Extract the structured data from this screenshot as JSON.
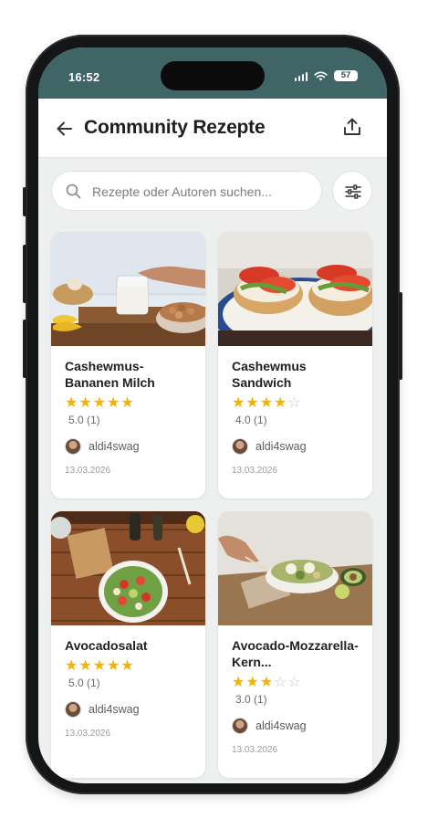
{
  "status_bar": {
    "time": "16:52",
    "battery": "57"
  },
  "header": {
    "title": "Community Rezepte"
  },
  "search": {
    "placeholder": "Rezepte oder Autoren suchen..."
  },
  "recipes": [
    {
      "title": "Cashewmus-Bananen Milch",
      "stars": 5,
      "rating": "5.0 (1)",
      "author": "aldi4swag",
      "date": "13.03.2026"
    },
    {
      "title": "Cashewmus Sandwich",
      "stars": 4,
      "rating": "4.0 (1)",
      "author": "aldi4swag",
      "date": "13.03.2026"
    },
    {
      "title": "Avocadosalat",
      "stars": 5,
      "rating": "5.0 (1)",
      "author": "aldi4swag",
      "date": "13.03.2026"
    },
    {
      "title": "Avocado-Mozzarella-Kern...",
      "stars": 3,
      "rating": "3.0 (1)",
      "author": "aldi4swag",
      "date": "13.03.2026"
    }
  ],
  "colors": {
    "status_bar": "#3f6566",
    "star": "#f5b301",
    "background": "#eef0f0"
  }
}
